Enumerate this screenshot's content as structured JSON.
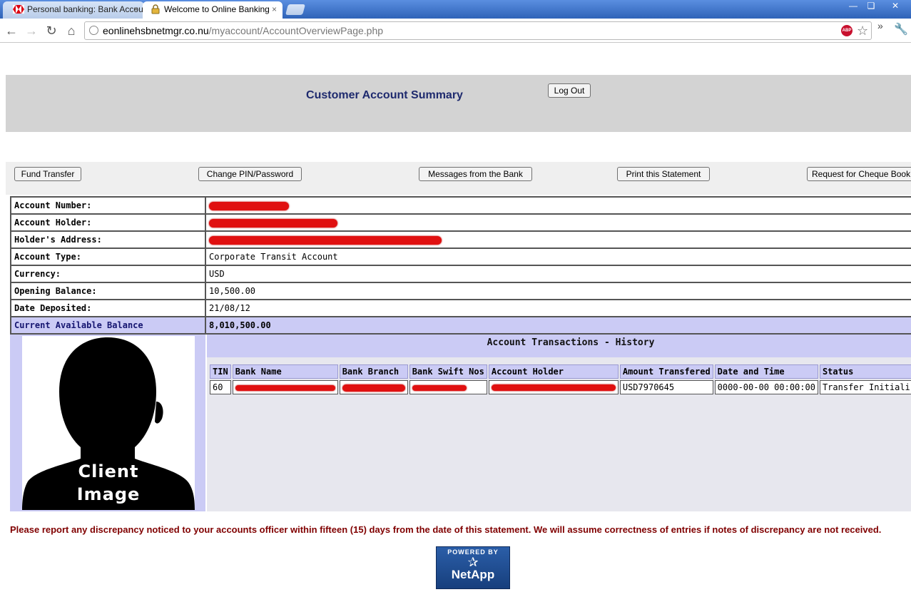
{
  "browser": {
    "tabs": [
      {
        "title": "Personal banking: Bank Accour",
        "active": false,
        "icon": "hsbc-logo-icon"
      },
      {
        "title": "Welcome to Online Banking",
        "active": true,
        "icon": "lock-icon"
      }
    ],
    "tab_close": "×",
    "url_host": "eonlinehsbnetmgr.co.nu",
    "url_path": "/myaccount/AccountOverviewPage.php",
    "adblock_label": "ABP"
  },
  "header": {
    "title": "Customer Account Summary",
    "logout_label": "Log Out"
  },
  "actions": {
    "fund_transfer": "Fund Transfer",
    "change_pin": "Change PIN/Password",
    "messages": "Messages from the Bank",
    "print": "Print this Statement",
    "request_cheque": "Request for Cheque Book"
  },
  "account": {
    "rows": [
      {
        "label": "Account Number:",
        "value": "",
        "redacted": true
      },
      {
        "label": "Account Holder:",
        "value": "",
        "redacted": true
      },
      {
        "label": "Holder's Address:",
        "value": "",
        "redacted": true
      },
      {
        "label": "Account Type:",
        "value": "Corporate Transit Account"
      },
      {
        "label": "Currency:",
        "value": "USD"
      },
      {
        "label": "Opening Balance:",
        "value": "10,500.00"
      },
      {
        "label": "Date Deposited:",
        "value": "21/08/12"
      }
    ],
    "balance_label": "Current Available Balance",
    "balance_value": "8,010,500.00"
  },
  "client_image": {
    "caption_line1": "Client",
    "caption_line2": "Image"
  },
  "history": {
    "title": "Account Transactions - History",
    "columns": [
      "TIN",
      "Bank Name",
      "Bank Branch",
      "Bank Swift Nos",
      "Account Holder",
      "Amount Transfered",
      "Date and Time",
      "Status"
    ],
    "rows": [
      {
        "tin": "60",
        "bank_name": "",
        "bank_branch": "",
        "swift": "",
        "holder": "",
        "amount": "USD7970645",
        "datetime": "0000-00-00 00:00:00",
        "status": "Transfer Initialized"
      }
    ]
  },
  "notice": "Please report any discrepancy noticed to your accounts officer within fifteen (15) days from the date of this statement. We will assume correctness of entries if notes of discrepancy are not received.",
  "footer_badge": {
    "powered_by": "POWERED BY",
    "brand": "NetApp"
  },
  "colors": {
    "tab_bar": "#2f63b8",
    "header_band": "#d3d3d3",
    "highlight_row": "#cbcbf5",
    "notice_text": "#800000",
    "title_text": "#1e2a6e",
    "redaction": "#e01010"
  }
}
